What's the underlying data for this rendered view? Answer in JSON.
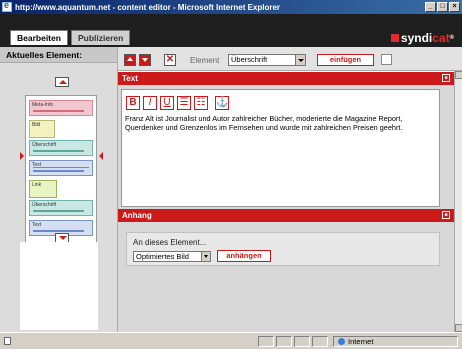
{
  "window": {
    "title": "http://www.aquantum.net - content editor - Microsoft Internet Explorer",
    "controls": [
      "_",
      "□",
      "×"
    ]
  },
  "tabs": [
    {
      "label": "Bearbeiten",
      "active": true
    },
    {
      "label": "Publizieren",
      "active": false
    }
  ],
  "logo": {
    "brand": "syndi",
    "accent": "cat",
    "mark": "®"
  },
  "left_panel": {
    "header": "Aktuelles Element:",
    "thumbnails": [
      "Meta-Info",
      "Bild",
      "Überschrift",
      "Text",
      "Link",
      "Überschrift",
      "Text"
    ]
  },
  "toolbar": {
    "element_label": "Element",
    "element_select": "Überschrift",
    "insert_button": "einfügen"
  },
  "text_section": {
    "title": "Text",
    "format_buttons": [
      "B",
      "I",
      "U",
      "☰",
      "☷",
      "⚓"
    ],
    "body": "Franz Alt ist Journalist und Autor zahlreicher Bücher, moderierte die Magazine Report, Querdenker und Grenzenlos im Fernsehen und wurde mit zahlreichen Preisen geehrt."
  },
  "attachment_section": {
    "title": "Anhang",
    "label": "An dieses Element...",
    "select_value": "Optimiertes Bild",
    "attach_button": "anhängen"
  },
  "statusbar": {
    "zone": "Internet"
  },
  "colors": {
    "accent": "#cc1a1a",
    "dark": "#1e1e1e"
  }
}
